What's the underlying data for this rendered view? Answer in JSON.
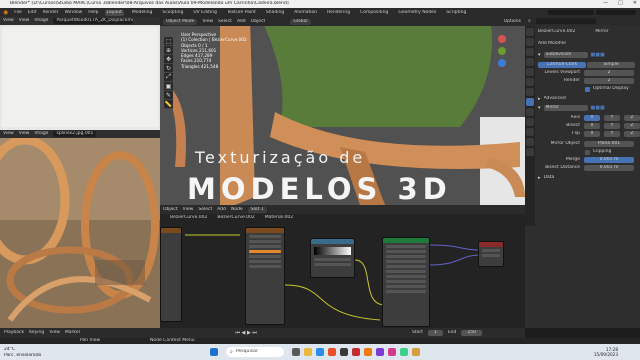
{
  "titlebar": {
    "text": "Blender* [D:\\Cursos\\Studio MARC\\Curso 3\\Blender\\08-Arquivos das Aulas\\Aula 09-Modelando um Carrinho\\Cadeira.blend]",
    "controls": [
      "—",
      "□",
      "✕"
    ]
  },
  "menubar": {
    "items": [
      "File",
      "Edit",
      "Render",
      "Window",
      "Help"
    ],
    "workspaces": [
      "Layout",
      "Modeling",
      "Sculpting",
      "UV Editing",
      "Texture Paint",
      "Shading",
      "Animation",
      "Rendering",
      "Compositing",
      "Geometry Nodes",
      "Scripting"
    ],
    "active_workspace": "Layout",
    "scene": "Scene",
    "view_layer": "ViewLayer"
  },
  "image_editor": {
    "menus": [
      "View",
      "View",
      "Image"
    ],
    "image_name": "ParquetWood017A_2K_Displacement.jpg"
  },
  "image_editor2": {
    "menus": [
      "View",
      "View",
      "Image"
    ],
    "image_name": "splines2.jpg.001"
  },
  "viewport": {
    "mode": "Object Mode",
    "menus": [
      "View",
      "Select",
      "Add",
      "Object"
    ],
    "orientation": "Global",
    "options": "Options",
    "stats": [
      "User Perspective",
      "(1) Colection | BezierCurve.002",
      "Objects    0 / 1",
      "Vertices   211,601",
      "Edges      417,289",
      "Faces      210,774",
      "Triangles  421,548"
    ]
  },
  "overlay": {
    "line1": "Texturização de",
    "line2": "MODELOS 3D"
  },
  "node_editor": {
    "menus": [
      "Object",
      "View",
      "Select",
      "Add",
      "Node"
    ],
    "breadcrumb": [
      "BezierCurve.002",
      "BezierCurve.002",
      "Material.002"
    ],
    "slot": "Slot 1"
  },
  "properties": {
    "search_placeholder": "",
    "object": "BezierCurve.002",
    "modifier_name": "Mirror",
    "add_modifier": "Add Modifier",
    "subdiv": {
      "name": "Subdivision",
      "modes": [
        "Catmull-Clark",
        "Simple"
      ],
      "levels_viewport_label": "Levels Viewport",
      "levels_viewport": "2",
      "render_label": "Render",
      "render": "2",
      "optimal": "Optimal Display",
      "advanced": "Advanced"
    },
    "mirror": {
      "name": "Mirror",
      "axis_label": "Axis",
      "bisect_label": "Bisect",
      "flip_label": "Flip",
      "axes": [
        "X",
        "Y",
        "Z"
      ],
      "mirror_object_label": "Mirror Object",
      "mirror_object": "Plane.001",
      "clipping": "Clipping",
      "merge_label": "Merge",
      "merge": "0.001 m",
      "bisect_distance_label": "Bisect Distance",
      "bisect_distance": "0.001 m",
      "data": "Data"
    }
  },
  "timeline": {
    "menus": [
      "Playback",
      "Keying",
      "View",
      "Marker"
    ],
    "start_label": "Start",
    "start": "1",
    "end_label": "End",
    "end": "250"
  },
  "statusbar": {
    "left": "Pan View",
    "mid": "Node Context Menu"
  },
  "taskbar": {
    "search": "Pesquisar",
    "weather_temp": "24°C",
    "weather_desc": "Parc. ensolarado",
    "time": "17:28",
    "date": "15/09/2023"
  },
  "colors": {
    "accent": "#4772b3",
    "wood": "#c98a55",
    "fabric": "#5a7c3a"
  }
}
